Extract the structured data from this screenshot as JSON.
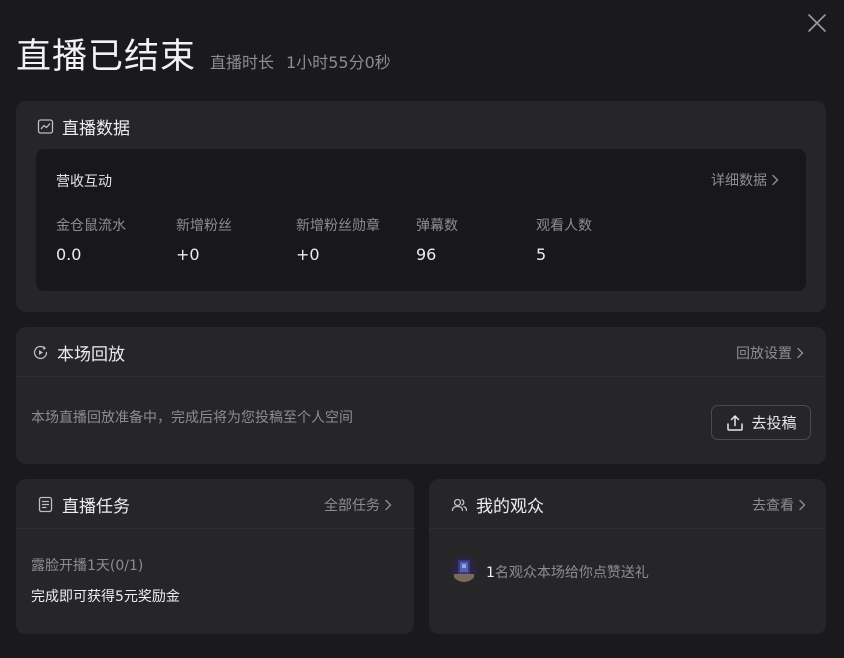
{
  "header": {
    "title": "直播已结束",
    "duration_label": "直播时长",
    "duration_value": "1小时55分0秒"
  },
  "live_data": {
    "title": "直播数据",
    "section_title": "营收互动",
    "detail_link": "详细数据",
    "stats": [
      {
        "label": "金仓鼠流水",
        "value": "0.0"
      },
      {
        "label": "新增粉丝",
        "value": "+0"
      },
      {
        "label": "新增粉丝勋章",
        "value": "+0"
      },
      {
        "label": "弹幕数",
        "value": "96"
      },
      {
        "label": "观看人数",
        "value": "5"
      }
    ]
  },
  "replay": {
    "title": "本场回放",
    "settings_link": "回放设置",
    "description": "本场直播回放准备中，完成后将为您投稿至个人空间",
    "upload_button": "去投稿"
  },
  "tasks": {
    "title": "直播任务",
    "all_link": "全部任务",
    "task_name": "露脸开播1天(0/1)",
    "task_reward": "完成即可获得5元奖励金"
  },
  "audience": {
    "title": "我的观众",
    "view_link": "去查看",
    "count": "1",
    "text": "名观众本场给你点赞送礼"
  },
  "icons": {
    "close": "close-icon",
    "chart": "line-chart-icon",
    "replay": "play-circle-icon",
    "upload": "upload-icon",
    "task": "document-icon",
    "audience": "users-icon",
    "chevron": "chevron-right-icon"
  }
}
